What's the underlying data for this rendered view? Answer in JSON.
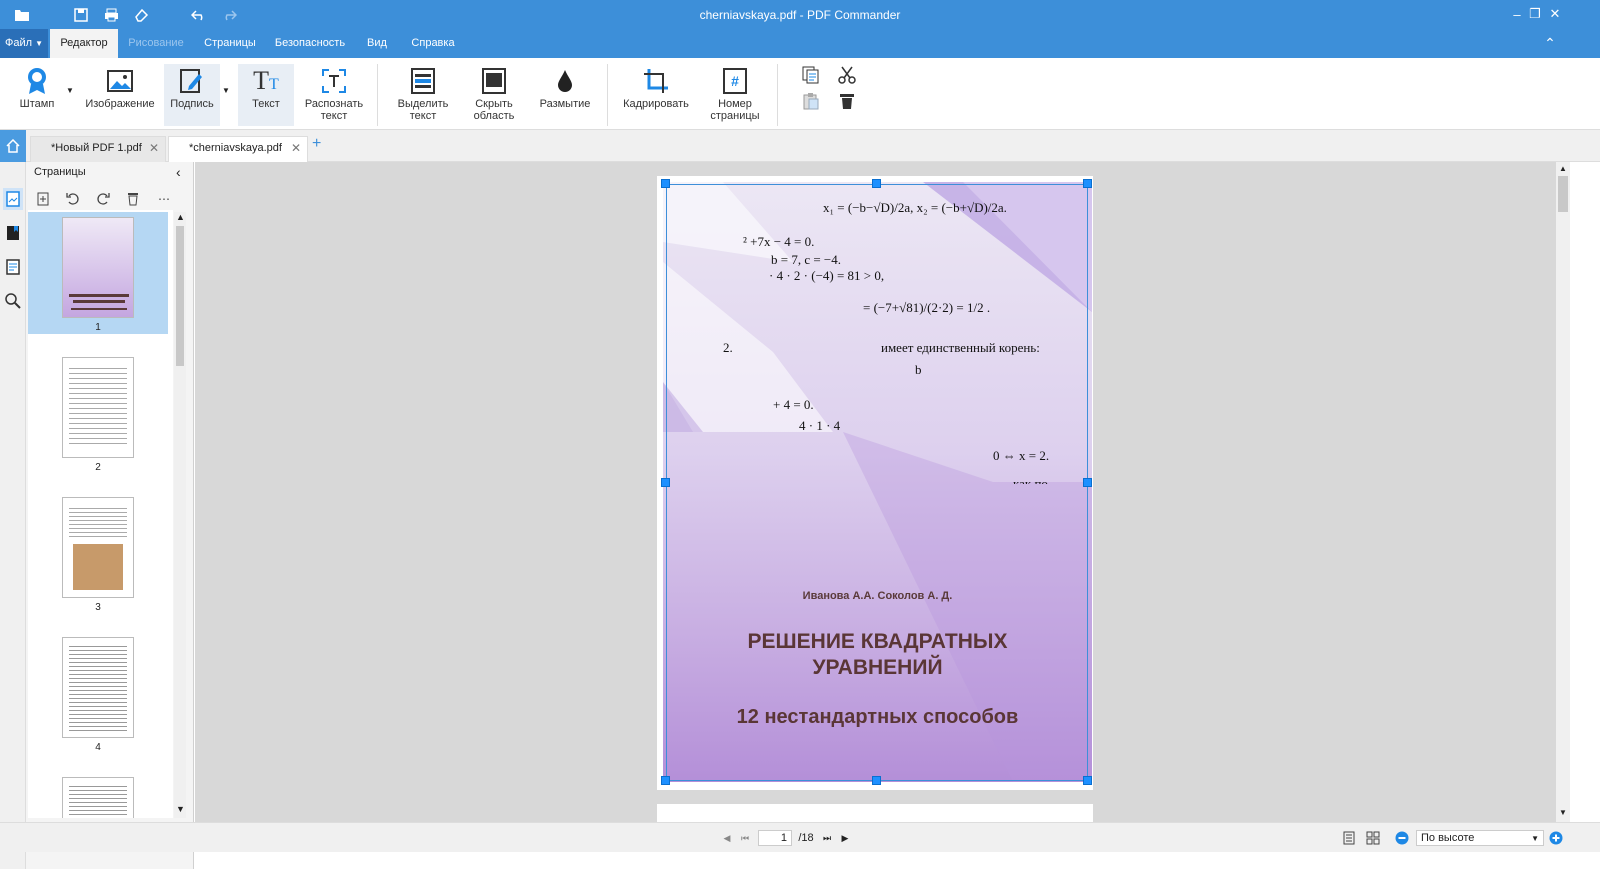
{
  "window": {
    "title": "cherniavskaya.pdf - PDF Commander"
  },
  "menu": {
    "file": "Файл",
    "items": [
      "Редактор",
      "Рисование",
      "Страницы",
      "Безопасность",
      "Вид",
      "Справка"
    ]
  },
  "ribbon": {
    "stamp": "Штамп",
    "image": "Изображение",
    "signature": "Подпись",
    "text": "Текст",
    "recognize_l1": "Распознать",
    "recognize_l2": "текст",
    "highlight_l1": "Выделить",
    "highlight_l2": "текст",
    "hide_l1": "Скрыть",
    "hide_l2": "область",
    "blur": "Размытие",
    "crop": "Кадрировать",
    "pagenum_l1": "Номер",
    "pagenum_l2": "страницы"
  },
  "tabs": [
    {
      "label": "*Новый PDF 1.pdf"
    },
    {
      "label": "*cherniavskaya.pdf"
    }
  ],
  "pages_panel": {
    "title": "Страницы",
    "thumbs": [
      "1",
      "2",
      "3",
      "4"
    ]
  },
  "document": {
    "authors": "Иванова А.А. Соколов А. Д.",
    "title_l1": "РЕШЕНИЕ КВАДРАТНЫХ",
    "title_l2": "УРАВНЕНИЙ",
    "subtitle": "12 нестандартных способов",
    "math": {
      "m1": "x₁ = (−b−√D)/2a,  x₂ = (−b+√D)/2a.",
      "m2": "² +7x − 4 = 0.",
      "m3": "b = 7,  c = −4.",
      "m4": "· 4 · 2 · (−4) = 81 > 0,",
      "m5": "= (−7+√81)/(2·2) = 1/2 .",
      "m6": "2.",
      "m7": "имеет  единственный корень:",
      "m8": "b",
      "m9": "+ 4 = 0.",
      "m10": "4 · 1 · 4",
      "m11": "0 ⇔ x = 2.",
      "m12": "как по"
    }
  },
  "status": {
    "page": "1",
    "total": "/18",
    "zoom": "По высоте"
  }
}
